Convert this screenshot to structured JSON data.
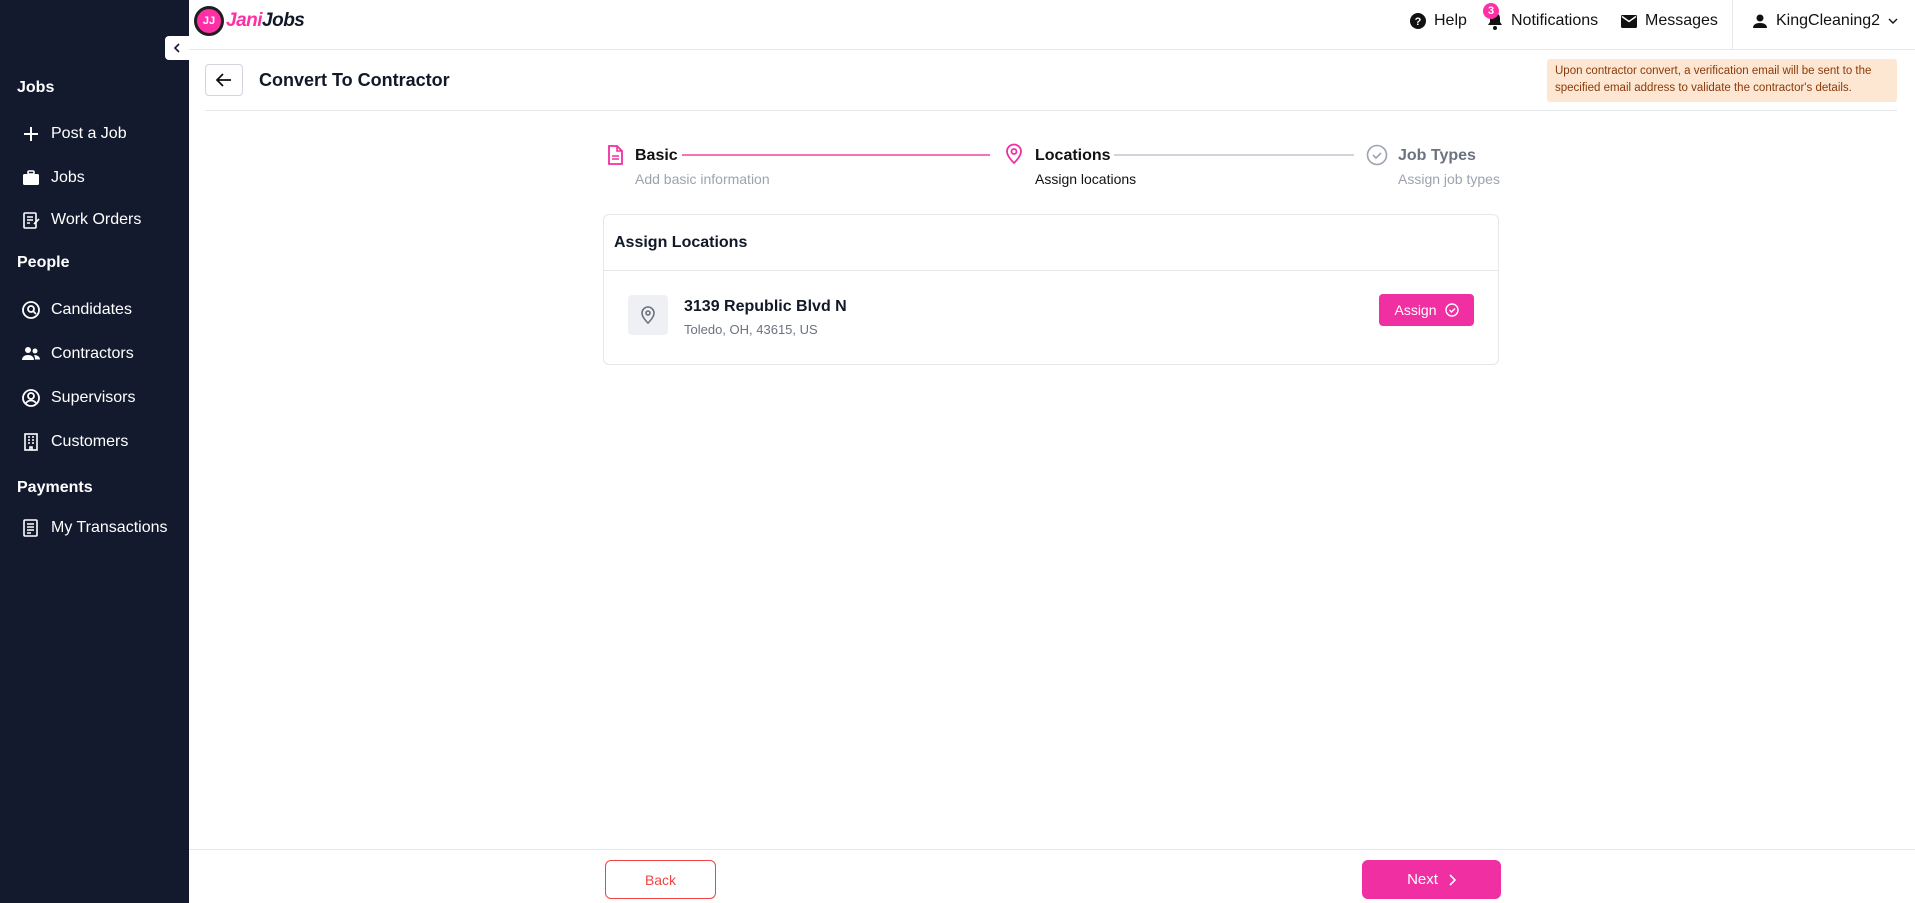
{
  "brand": {
    "logo_initials": "JJ",
    "logo_part1": "Jani",
    "logo_part2": "Jobs",
    "accent": "#f02fa2",
    "sidebar_bg": "#131a2e"
  },
  "sidebar": {
    "sections": [
      {
        "label": "Jobs",
        "items": [
          {
            "label": "Post a Job",
            "icon": "plus-icon"
          },
          {
            "label": "Jobs",
            "icon": "briefcase-icon"
          },
          {
            "label": "Work Orders",
            "icon": "clipboard-edit-icon"
          }
        ]
      },
      {
        "label": "People",
        "items": [
          {
            "label": "Candidates",
            "icon": "search-person-icon"
          },
          {
            "label": "Contractors",
            "icon": "users-icon"
          },
          {
            "label": "Supervisors",
            "icon": "user-circle-icon"
          },
          {
            "label": "Customers",
            "icon": "building-icon"
          }
        ]
      },
      {
        "label": "Payments",
        "items": [
          {
            "label": "My Transactions",
            "icon": "receipt-icon"
          }
        ]
      }
    ]
  },
  "topbar": {
    "help": "Help",
    "notifications": "Notifications",
    "notifications_count": "3",
    "messages": "Messages",
    "user": "KingCleaning2"
  },
  "page": {
    "title": "Convert To Contractor",
    "notice": "Upon contractor convert, a verification email will be sent to the specified email address to validate the contractor's details."
  },
  "stepper": [
    {
      "title": "Basic",
      "subtitle": "Add basic information",
      "state": "done"
    },
    {
      "title": "Locations",
      "subtitle": "Assign locations",
      "state": "active"
    },
    {
      "title": "Job Types",
      "subtitle": "Assign job types",
      "state": "pending"
    }
  ],
  "card": {
    "title": "Assign Locations",
    "locations": [
      {
        "name": "3139 Republic Blvd N",
        "address": "Toledo, OH, 43615, US",
        "action": "Assign"
      }
    ]
  },
  "footer": {
    "back": "Back",
    "next": "Next"
  }
}
